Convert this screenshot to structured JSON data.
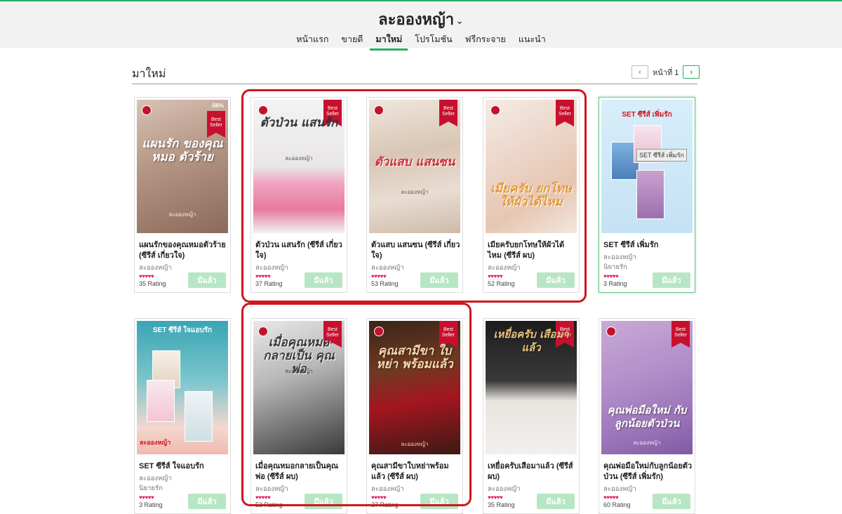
{
  "header": {
    "title": "ละอองหญ้า",
    "chevron": "⌄"
  },
  "nav": {
    "items": [
      "หน้าแรก",
      "ขายดี",
      "มาใหม่",
      "โปรโมชัน",
      "ฟรีกระจาย",
      "แนะนำ"
    ]
  },
  "section": {
    "title": "มาใหม่"
  },
  "pager": {
    "prev": "‹",
    "label": "หน้าที่ 1",
    "next": "›"
  },
  "books": [
    {
      "title": "แผนรักของคุณหมอตัวร้าย (ซีรีส์ เกี่ยวใจ)",
      "author": "ละอองหญ้า",
      "hearts": "♥♥♥♥♥",
      "rating": "35 Rating",
      "button": "มีแล้ว",
      "discount": "-56%",
      "ribbon": "Best Seller",
      "cover_text": "แผนรัก ของคุณหมอ ตัวร้าย",
      "cover_author": "ละอองหญ้า"
    },
    {
      "title": "ตัวป่วน แสนรัก (ซีรีส์ เกี่ยวใจ)",
      "author": "ละอองหญ้า",
      "hearts": "♥♥♥♥♥",
      "rating": "37 Rating",
      "button": "มีแล้ว",
      "ribbon": "Best Seller",
      "cover_text": "ตัวป่วน แสนรัก",
      "cover_author": "ละอองหญ้า"
    },
    {
      "title": "ตัวแสบ แสนซน (ซีรีส์ เกี่ยวใจ)",
      "author": "ละอองหญ้า",
      "hearts": "♥♥♥♥♥",
      "rating": "53 Rating",
      "button": "มีแล้ว",
      "ribbon": "Best Seller",
      "cover_text": "ตัวแสบ แสนซน",
      "cover_author": "ละอองหญ้า"
    },
    {
      "title": "เมียครับยกโทษให้ผัวได้ไหม (ซีรีส์ ผบ)",
      "author": "ละอองหญ้า",
      "hearts": "♥♥♥♥♥",
      "rating": "52 Rating",
      "button": "มีแล้ว",
      "ribbon": "Best Seller",
      "cover_text": "เมียครับ ยกโทษ ให้ผัวได้ไหม",
      "cover_author": "ละอองหญ้า"
    },
    {
      "title": "SET ซีรีส์ เพิ่มรัก",
      "author": "ละอองหญ้า",
      "publisher": "นิยายรัก",
      "hearts": "♥♥♥♥♥",
      "rating": "3 Rating",
      "button": "มีแล้ว",
      "cover_text": "SET ซีรีส์ เพิ่มรัก",
      "tooltip": "SET ซีรีส์ เพิ่มรัก"
    },
    {
      "title": "SET ซีรีส์ ใจแอบรัก",
      "author": "ละอองหญ้า",
      "publisher": "นิยายรัก",
      "hearts": "♥♥♥♥♥",
      "rating": "3 Rating",
      "button": "มีแล้ว",
      "cover_text": "SET ซีรีส์ ใจแอบรัก",
      "cover_author": "ละอองหญ้า"
    },
    {
      "title": "เมื่อคุณหมอกลายเป็นคุณพ่อ (ซีรีส์ ผบ)",
      "author": "ละอองหญ้า",
      "hearts": "♥♥♥♥♥",
      "rating": "53 Rating",
      "button": "มีแล้ว",
      "ribbon": "Best Seller",
      "cover_text": "เมื่อคุณหมอ กลายเป็น คุณพ่อ",
      "cover_author": "ละอองหญ้า"
    },
    {
      "title": "คุณสามีขาใบหย่าพร้อมแล้ว (ซีรีส์ ผบ)",
      "author": "ละอองหญ้า",
      "hearts": "♥♥♥♥♥",
      "rating": "37 Rating",
      "button": "มีแล้ว",
      "ribbon": "Best Seller",
      "cover_text": "คุณสามีขา ใบหย่า พร้อมแล้ว",
      "cover_author": "ละอองหญ้า"
    },
    {
      "title": "เหยื่อครับเสือมาแล้ว (ซีรีส์ ผบ)",
      "author": "ละอองหญ้า",
      "hearts": "♥♥♥♥♥",
      "rating": "35 Rating",
      "button": "มีแล้ว",
      "ribbon": "Best Seller",
      "cover_text": "เหยื่อครับ เสือมาแล้ว"
    },
    {
      "title": "คุณพ่อมือใหม่กับลูกน้อยตัวป่วน (ซีรีส์ เพิ่มรัก)",
      "author": "ละอองหญ้า",
      "hearts": "♥♥♥♥♥",
      "rating": "60 Rating",
      "button": "มีแล้ว",
      "ribbon": "Best Seller",
      "cover_text": "คุณพ่อมือใหม่ กับ ลูกน้อยตัวป่วน",
      "cover_author": "ละอองหญ้า"
    }
  ],
  "colors": {
    "accent": "#27ae60",
    "annotation": "#d0161d",
    "heart": "#e0195a",
    "ribbon": "#c8102e"
  }
}
